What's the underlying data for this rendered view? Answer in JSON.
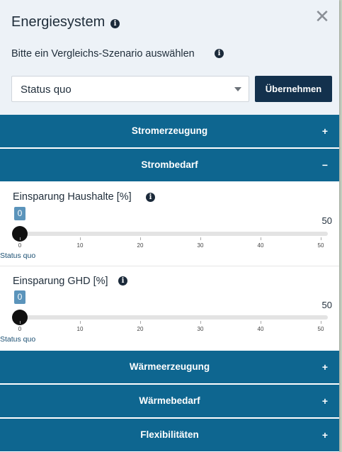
{
  "header": {
    "title": "Energiesystem",
    "close_symbol": "✕",
    "subtitle": "Bitte ein Vergleichs-Szenario auswählen",
    "select_value": "Status quo",
    "apply_label": "Übernehmen",
    "info_icon_glyph": "i"
  },
  "accordion": {
    "stromerzeugung": {
      "label": "Stromerzeugung",
      "toggle": "+"
    },
    "strombedarf": {
      "label": "Strombedarf",
      "toggle": "−"
    },
    "waermeerzeugung": {
      "label": "Wärmeerzeugung",
      "toggle": "+"
    },
    "waermebedarf": {
      "label": "Wärmebedarf",
      "toggle": "+"
    },
    "flexibilitaeten": {
      "label": "Flexibilitäten",
      "toggle": "+"
    }
  },
  "sliders": [
    {
      "label": "Einsparung Haushalte [%]",
      "value": "0",
      "max_label": "50",
      "ticks": [
        "0",
        "10",
        "20",
        "30",
        "40",
        "50"
      ],
      "marker_label": "Status quo"
    },
    {
      "label": "Einsparung GHD [%]",
      "value": "0",
      "max_label": "50",
      "ticks": [
        "0",
        "10",
        "20",
        "30",
        "40",
        "50"
      ],
      "marker_label": "Status quo"
    }
  ],
  "colors": {
    "accordion_bg": "#0e6690",
    "button_bg": "#13314d",
    "badge_bg": "#5b94bb",
    "header_bg": "#edf2f7"
  }
}
